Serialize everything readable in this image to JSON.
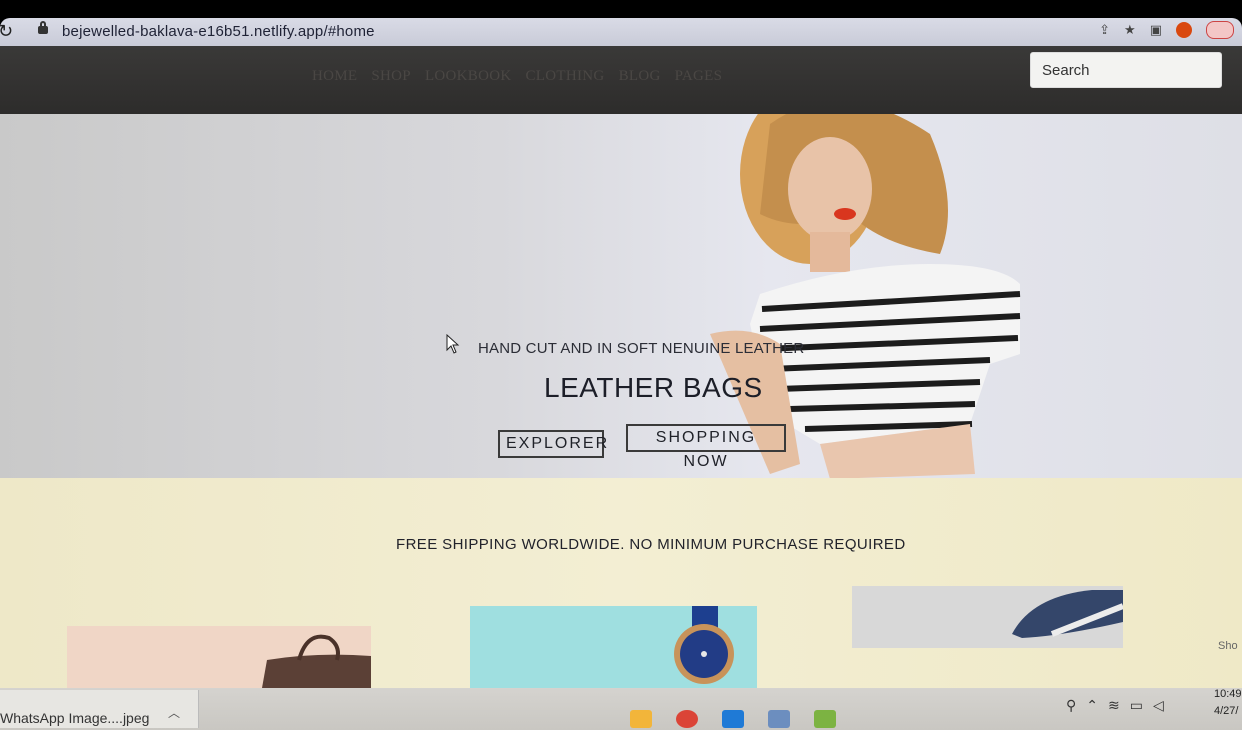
{
  "browser": {
    "url": "bejewelled-baklava-e16b51.netlify.app/#home"
  },
  "nav": {
    "links": [
      "HOME",
      "SHOP",
      "LOOKBOOK",
      "CLOTHING",
      "BLOG",
      "PAGES"
    ],
    "search_placeholder": "Search"
  },
  "hero": {
    "subtitle": "HAND CUT AND IN SOFT NENUINE LEATHER",
    "title": "LEATHER BAGS",
    "buttons": [
      "EXPLORER",
      "SHOPPING NOW"
    ]
  },
  "banner": {
    "text": "FREE SHIPPING WORLDWIDE. NO MINIMUM PURCHASE REQUIRED"
  },
  "products": [
    {
      "icon": "bag-image"
    },
    {
      "icon": "watch-image"
    },
    {
      "icon": "shoe-image"
    }
  ],
  "side_edge_text": "Sho",
  "download_bar": {
    "filename": "WhatsApp Image....jpeg"
  },
  "taskbar": {
    "time": "10:49",
    "date": "4/27/"
  },
  "colors": {
    "nav_bg": "#2f2e2d",
    "banner_bg": "#f1ecd0"
  }
}
